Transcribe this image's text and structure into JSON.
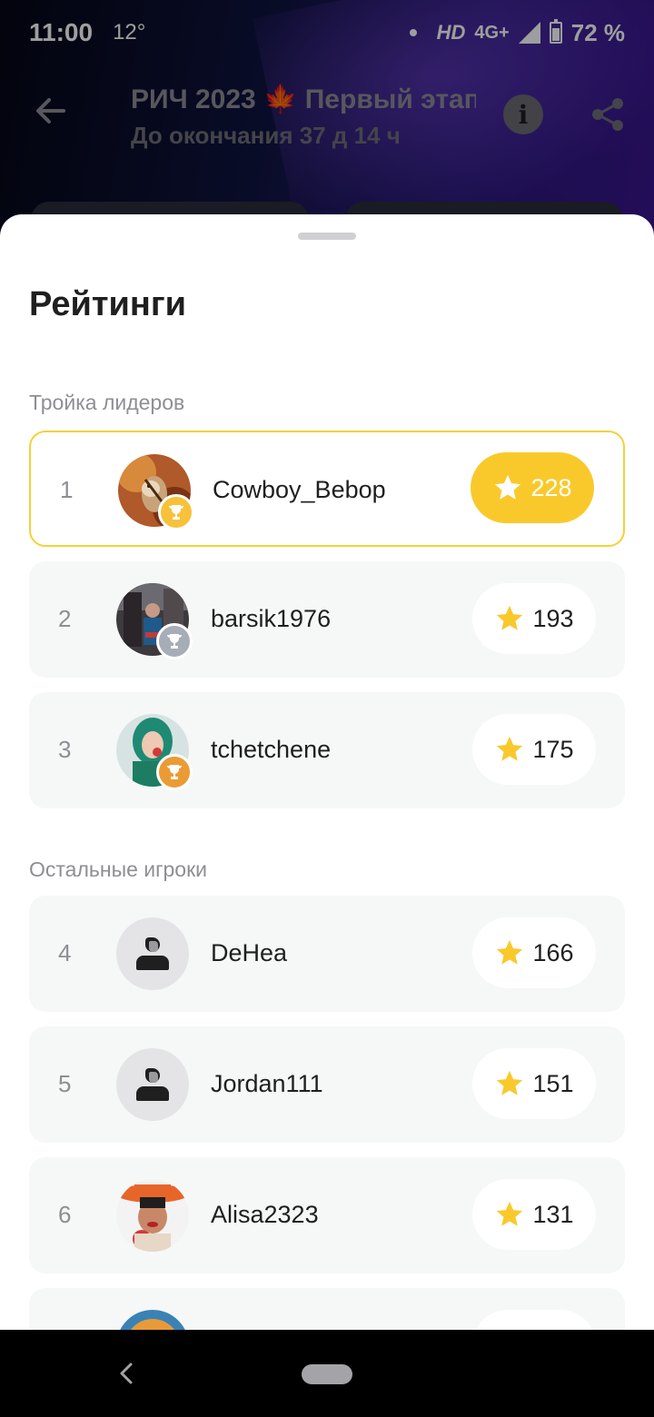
{
  "status_bar": {
    "time": "11:00",
    "temperature": "12°",
    "hd": "HD",
    "network": "4G+",
    "battery": "72 %"
  },
  "header": {
    "title": "РИЧ 2023 🍁 Первый этап",
    "subtitle": "До окончания 37 д 14 ч",
    "info_icon": "info-icon",
    "share_icon": "share-icon"
  },
  "sheet": {
    "title": "Рейтинги",
    "leaders_label": "Тройка лидеров",
    "others_label": "Остальные игроки"
  },
  "leaders": [
    {
      "rank": "1",
      "name": "Cowboy_Bebop",
      "score": "228",
      "trophy_color": "#f7c23a"
    },
    {
      "rank": "2",
      "name": "barsik1976",
      "score": "193",
      "trophy_color": "#a6adb7"
    },
    {
      "rank": "3",
      "name": "tchetchene",
      "score": "175",
      "trophy_color": "#eb9b34"
    }
  ],
  "others": [
    {
      "rank": "4",
      "name": "DeHea",
      "score": "166"
    },
    {
      "rank": "5",
      "name": "Jordan111",
      "score": "151"
    },
    {
      "rank": "6",
      "name": "Alisa2323",
      "score": "131"
    }
  ],
  "colors": {
    "accent": "#f9c92c",
    "star": "#f9c92c",
    "row_bg": "#f6f7f7"
  }
}
